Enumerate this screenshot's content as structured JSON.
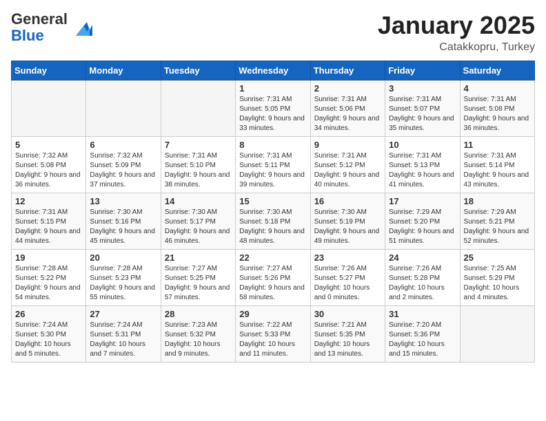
{
  "header": {
    "logo_line1": "General",
    "logo_line2": "Blue",
    "month": "January 2025",
    "location": "Catakkopru, Turkey"
  },
  "weekdays": [
    "Sunday",
    "Monday",
    "Tuesday",
    "Wednesday",
    "Thursday",
    "Friday",
    "Saturday"
  ],
  "weeks": [
    [
      {
        "day": "",
        "sunrise": "",
        "sunset": "",
        "daylight": ""
      },
      {
        "day": "",
        "sunrise": "",
        "sunset": "",
        "daylight": ""
      },
      {
        "day": "",
        "sunrise": "",
        "sunset": "",
        "daylight": ""
      },
      {
        "day": "1",
        "sunrise": "Sunrise: 7:31 AM",
        "sunset": "Sunset: 5:05 PM",
        "daylight": "Daylight: 9 hours and 33 minutes."
      },
      {
        "day": "2",
        "sunrise": "Sunrise: 7:31 AM",
        "sunset": "Sunset: 5:06 PM",
        "daylight": "Daylight: 9 hours and 34 minutes."
      },
      {
        "day": "3",
        "sunrise": "Sunrise: 7:31 AM",
        "sunset": "Sunset: 5:07 PM",
        "daylight": "Daylight: 9 hours and 35 minutes."
      },
      {
        "day": "4",
        "sunrise": "Sunrise: 7:31 AM",
        "sunset": "Sunset: 5:08 PM",
        "daylight": "Daylight: 9 hours and 36 minutes."
      }
    ],
    [
      {
        "day": "5",
        "sunrise": "Sunrise: 7:32 AM",
        "sunset": "Sunset: 5:08 PM",
        "daylight": "Daylight: 9 hours and 36 minutes."
      },
      {
        "day": "6",
        "sunrise": "Sunrise: 7:32 AM",
        "sunset": "Sunset: 5:09 PM",
        "daylight": "Daylight: 9 hours and 37 minutes."
      },
      {
        "day": "7",
        "sunrise": "Sunrise: 7:31 AM",
        "sunset": "Sunset: 5:10 PM",
        "daylight": "Daylight: 9 hours and 38 minutes."
      },
      {
        "day": "8",
        "sunrise": "Sunrise: 7:31 AM",
        "sunset": "Sunset: 5:11 PM",
        "daylight": "Daylight: 9 hours and 39 minutes."
      },
      {
        "day": "9",
        "sunrise": "Sunrise: 7:31 AM",
        "sunset": "Sunset: 5:12 PM",
        "daylight": "Daylight: 9 hours and 40 minutes."
      },
      {
        "day": "10",
        "sunrise": "Sunrise: 7:31 AM",
        "sunset": "Sunset: 5:13 PM",
        "daylight": "Daylight: 9 hours and 41 minutes."
      },
      {
        "day": "11",
        "sunrise": "Sunrise: 7:31 AM",
        "sunset": "Sunset: 5:14 PM",
        "daylight": "Daylight: 9 hours and 43 minutes."
      }
    ],
    [
      {
        "day": "12",
        "sunrise": "Sunrise: 7:31 AM",
        "sunset": "Sunset: 5:15 PM",
        "daylight": "Daylight: 9 hours and 44 minutes."
      },
      {
        "day": "13",
        "sunrise": "Sunrise: 7:30 AM",
        "sunset": "Sunset: 5:16 PM",
        "daylight": "Daylight: 9 hours and 45 minutes."
      },
      {
        "day": "14",
        "sunrise": "Sunrise: 7:30 AM",
        "sunset": "Sunset: 5:17 PM",
        "daylight": "Daylight: 9 hours and 46 minutes."
      },
      {
        "day": "15",
        "sunrise": "Sunrise: 7:30 AM",
        "sunset": "Sunset: 5:18 PM",
        "daylight": "Daylight: 9 hours and 48 minutes."
      },
      {
        "day": "16",
        "sunrise": "Sunrise: 7:30 AM",
        "sunset": "Sunset: 5:19 PM",
        "daylight": "Daylight: 9 hours and 49 minutes."
      },
      {
        "day": "17",
        "sunrise": "Sunrise: 7:29 AM",
        "sunset": "Sunset: 5:20 PM",
        "daylight": "Daylight: 9 hours and 51 minutes."
      },
      {
        "day": "18",
        "sunrise": "Sunrise: 7:29 AM",
        "sunset": "Sunset: 5:21 PM",
        "daylight": "Daylight: 9 hours and 52 minutes."
      }
    ],
    [
      {
        "day": "19",
        "sunrise": "Sunrise: 7:28 AM",
        "sunset": "Sunset: 5:22 PM",
        "daylight": "Daylight: 9 hours and 54 minutes."
      },
      {
        "day": "20",
        "sunrise": "Sunrise: 7:28 AM",
        "sunset": "Sunset: 5:23 PM",
        "daylight": "Daylight: 9 hours and 55 minutes."
      },
      {
        "day": "21",
        "sunrise": "Sunrise: 7:27 AM",
        "sunset": "Sunset: 5:25 PM",
        "daylight": "Daylight: 9 hours and 57 minutes."
      },
      {
        "day": "22",
        "sunrise": "Sunrise: 7:27 AM",
        "sunset": "Sunset: 5:26 PM",
        "daylight": "Daylight: 9 hours and 58 minutes."
      },
      {
        "day": "23",
        "sunrise": "Sunrise: 7:26 AM",
        "sunset": "Sunset: 5:27 PM",
        "daylight": "Daylight: 10 hours and 0 minutes."
      },
      {
        "day": "24",
        "sunrise": "Sunrise: 7:26 AM",
        "sunset": "Sunset: 5:28 PM",
        "daylight": "Daylight: 10 hours and 2 minutes."
      },
      {
        "day": "25",
        "sunrise": "Sunrise: 7:25 AM",
        "sunset": "Sunset: 5:29 PM",
        "daylight": "Daylight: 10 hours and 4 minutes."
      }
    ],
    [
      {
        "day": "26",
        "sunrise": "Sunrise: 7:24 AM",
        "sunset": "Sunset: 5:30 PM",
        "daylight": "Daylight: 10 hours and 5 minutes."
      },
      {
        "day": "27",
        "sunrise": "Sunrise: 7:24 AM",
        "sunset": "Sunset: 5:31 PM",
        "daylight": "Daylight: 10 hours and 7 minutes."
      },
      {
        "day": "28",
        "sunrise": "Sunrise: 7:23 AM",
        "sunset": "Sunset: 5:32 PM",
        "daylight": "Daylight: 10 hours and 9 minutes."
      },
      {
        "day": "29",
        "sunrise": "Sunrise: 7:22 AM",
        "sunset": "Sunset: 5:33 PM",
        "daylight": "Daylight: 10 hours and 11 minutes."
      },
      {
        "day": "30",
        "sunrise": "Sunrise: 7:21 AM",
        "sunset": "Sunset: 5:35 PM",
        "daylight": "Daylight: 10 hours and 13 minutes."
      },
      {
        "day": "31",
        "sunrise": "Sunrise: 7:20 AM",
        "sunset": "Sunset: 5:36 PM",
        "daylight": "Daylight: 10 hours and 15 minutes."
      },
      {
        "day": "",
        "sunrise": "",
        "sunset": "",
        "daylight": ""
      }
    ]
  ]
}
